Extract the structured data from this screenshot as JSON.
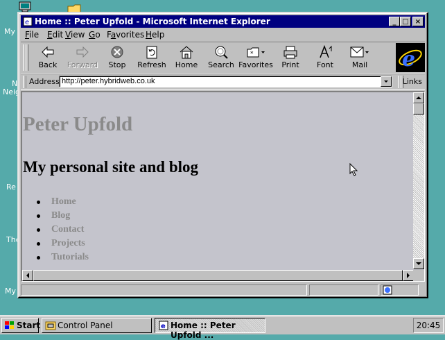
{
  "desktop": {
    "partial_labels": [
      "My",
      "N",
      "Neig",
      "Re",
      "The",
      "My"
    ]
  },
  "window": {
    "title": "Home :: Peter Upfold - Microsoft Internet Explorer",
    "controls": {
      "minimize": "_",
      "maximize": "□",
      "close": "×"
    }
  },
  "menubar": {
    "items": [
      {
        "label": "File",
        "accel": "F",
        "rest": "ile"
      },
      {
        "label": "Edit",
        "accel": "E",
        "rest": "dit"
      },
      {
        "label": "View",
        "accel": "V",
        "rest": "iew"
      },
      {
        "label": "Go",
        "accel": "G",
        "rest": "o"
      },
      {
        "label": "Favorites",
        "accel": "a",
        "rest": "vorites",
        "pre": "F"
      },
      {
        "label": "Help",
        "accel": "H",
        "rest": "elp"
      }
    ]
  },
  "toolbar": {
    "back": "Back",
    "forward": "Forward",
    "stop": "Stop",
    "refresh": "Refresh",
    "home": "Home",
    "search": "Search",
    "favorites": "Favorites",
    "print": "Print",
    "font": "Font",
    "mail": "Mail"
  },
  "addressbar": {
    "label": "Address",
    "url": "http://peter.hybridweb.co.uk",
    "links": "Links"
  },
  "page": {
    "heading": "Peter Upfold",
    "subheading": "My personal site and blog",
    "nav": [
      "Home",
      "Blog",
      "Contact",
      "Projects",
      "Tutorials"
    ]
  },
  "taskbar": {
    "start": "Start",
    "tasks": [
      "Control Panel",
      "Home :: Peter Upfold ..."
    ],
    "clock": "20:45"
  },
  "colors": {
    "desktop": "#55aaaa",
    "titlebar": "#000080",
    "page_background": "#c4c4cc",
    "link_gray": "#8a8a8a"
  }
}
